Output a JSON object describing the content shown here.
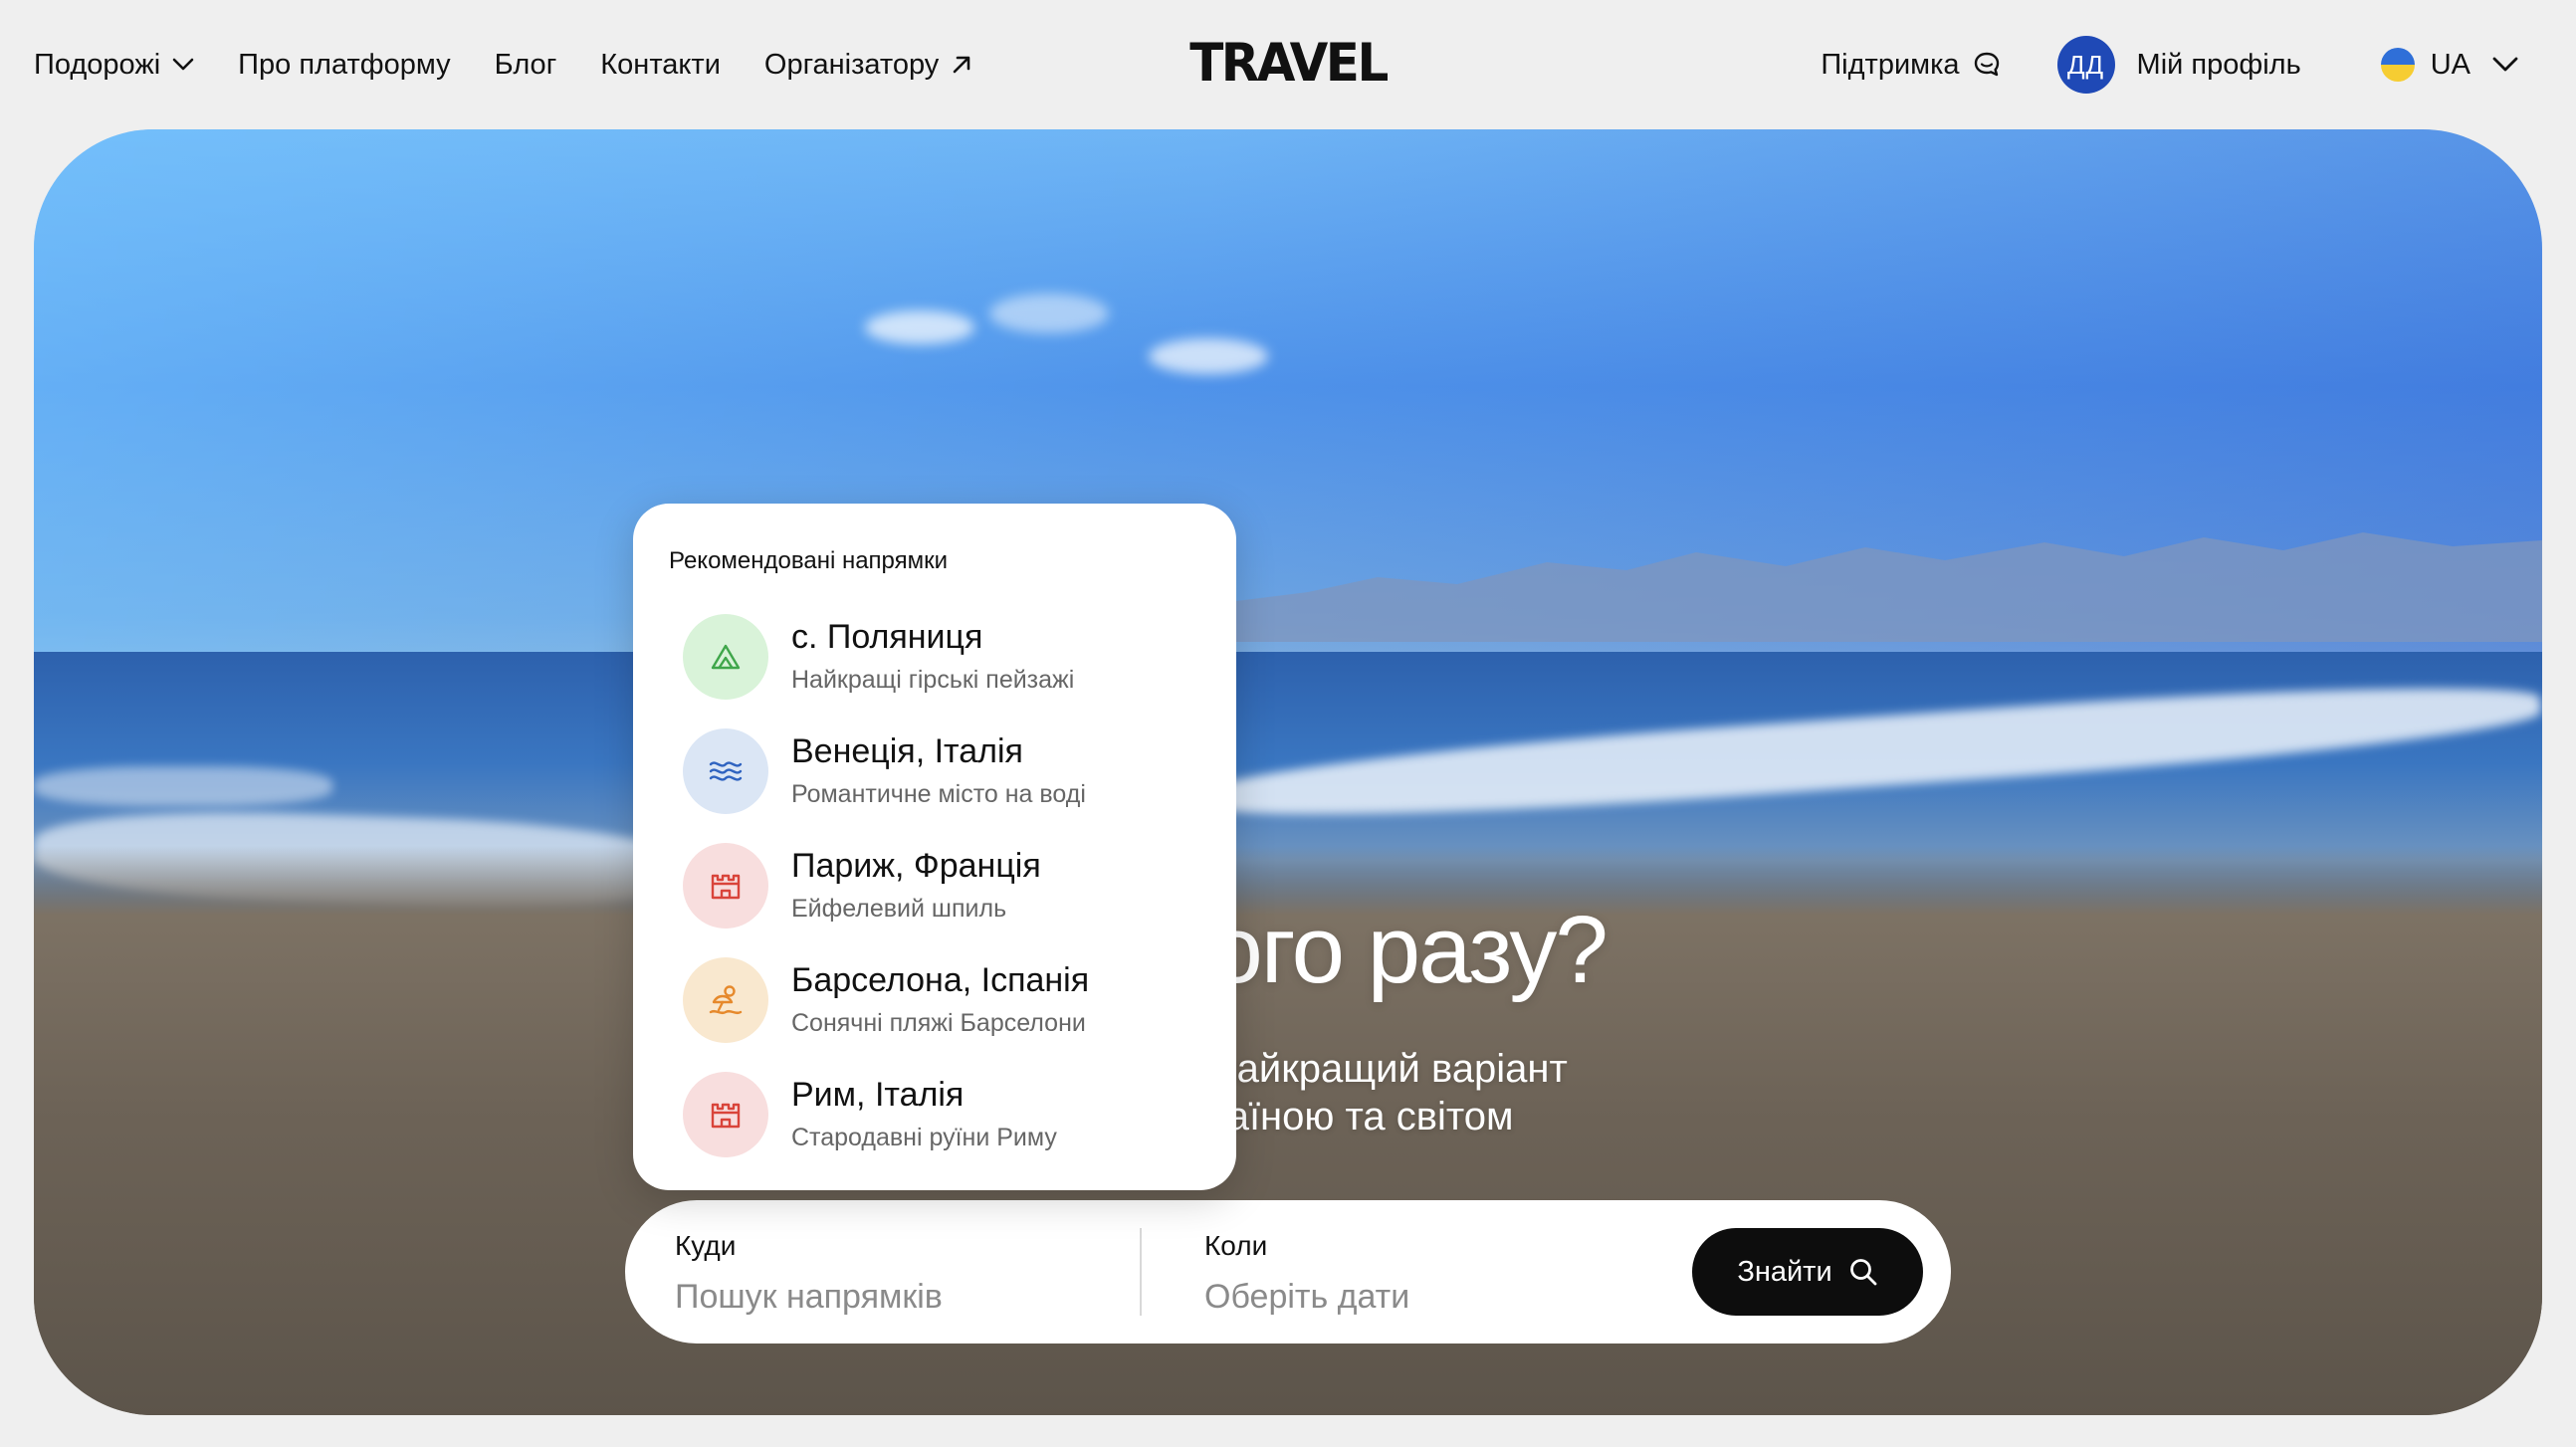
{
  "header": {
    "nav": [
      {
        "label": "Подорожі",
        "has_dropdown": true
      },
      {
        "label": "Про платформу"
      },
      {
        "label": "Блог"
      },
      {
        "label": "Контакти"
      },
      {
        "label": "Організатору",
        "external": true
      }
    ],
    "logo": "TRAVEL",
    "support_label": "Підтримка",
    "profile": {
      "initials": "ДД",
      "label": "Мій профіль"
    },
    "language": "UA"
  },
  "hero": {
    "title_visible": "мо цього разу?",
    "subtitle_lines": [
      "е шукаємо найкращий варіант",
      "турів Україною та світом"
    ]
  },
  "search": {
    "where_label": "Куди",
    "where_placeholder": "Пошук напрямків",
    "when_label": "Коли",
    "when_placeholder": "Оберіть дати",
    "button_label": "Знайти"
  },
  "dropdown": {
    "title": "Рекомендовані напрямки",
    "items": [
      {
        "name": "с. Поляниця",
        "desc": "Найкращі гірські пейзажі",
        "icon": "mountain-icon",
        "bg": "#d9f3d9",
        "color": "#3fa64a"
      },
      {
        "name": "Венеція, Італія",
        "desc": "Романтичне місто на воді",
        "icon": "waves-icon",
        "bg": "#dbe6f5",
        "color": "#2f63c0"
      },
      {
        "name": "Париж, Франція",
        "desc": "Ейфелевий шпиль",
        "icon": "castle-icon",
        "bg": "#f8dede",
        "color": "#d9443a"
      },
      {
        "name": "Барселона, Іспанія",
        "desc": "Сонячні пляжі Барселони",
        "icon": "beach-icon",
        "bg": "#f9e8cf",
        "color": "#e6892c"
      },
      {
        "name": "Рим, Італія",
        "desc": "Стародавні руїни Риму",
        "icon": "castle-icon",
        "bg": "#f8dede",
        "color": "#d9443a"
      }
    ]
  }
}
